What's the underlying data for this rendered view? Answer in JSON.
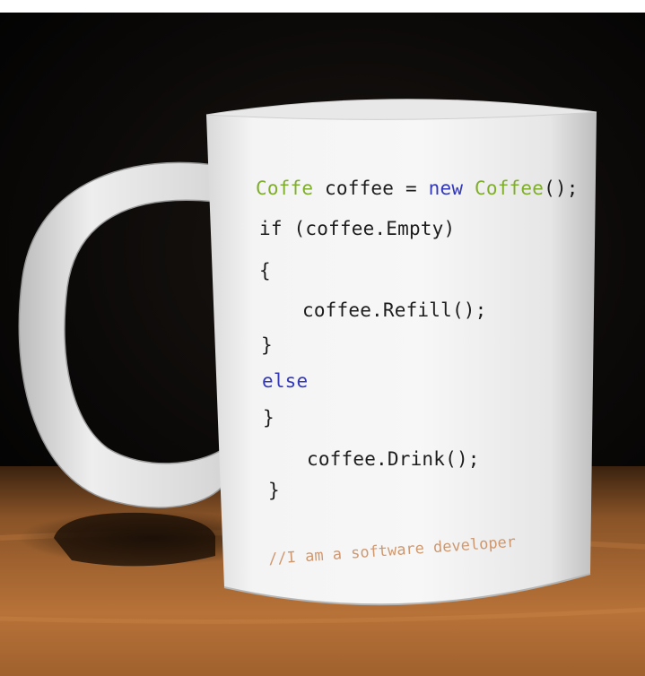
{
  "mug": {
    "code_lines": [
      {
        "tokens": [
          {
            "text": "Coffe",
            "kind": "type"
          },
          {
            "text": " coffee ",
            "kind": "plain"
          },
          {
            "text": "=",
            "kind": "plain"
          },
          {
            "text": " ",
            "kind": "plain"
          },
          {
            "text": "new",
            "kind": "keyword"
          },
          {
            "text": " ",
            "kind": "plain"
          },
          {
            "text": "Coffee",
            "kind": "type"
          },
          {
            "text": "();",
            "kind": "plain"
          }
        ]
      },
      {
        "tokens": [
          {
            "text": "if (coffee.Empty)",
            "kind": "plain"
          }
        ]
      },
      {
        "tokens": [
          {
            "text": "{",
            "kind": "plain"
          }
        ]
      },
      {
        "tokens": [
          {
            "text": "coffee.Refill();",
            "kind": "plain"
          }
        ]
      },
      {
        "tokens": [
          {
            "text": "}",
            "kind": "plain"
          }
        ]
      },
      {
        "tokens": [
          {
            "text": "else",
            "kind": "keyword"
          }
        ]
      },
      {
        "tokens": [
          {
            "text": "}",
            "kind": "plain"
          }
        ]
      },
      {
        "tokens": [
          {
            "text": "coffee.Drink();",
            "kind": "plain"
          }
        ]
      },
      {
        "tokens": [
          {
            "text": "}",
            "kind": "plain"
          }
        ]
      }
    ],
    "comment": "//I am a software developer"
  },
  "colors": {
    "type": "#7fae2a",
    "keyword": "#3338b8",
    "plain": "#1d1d1d",
    "comment": "#c8895a",
    "background": "#000000",
    "table": "#a86a34",
    "mug": "#f2f2f2"
  }
}
